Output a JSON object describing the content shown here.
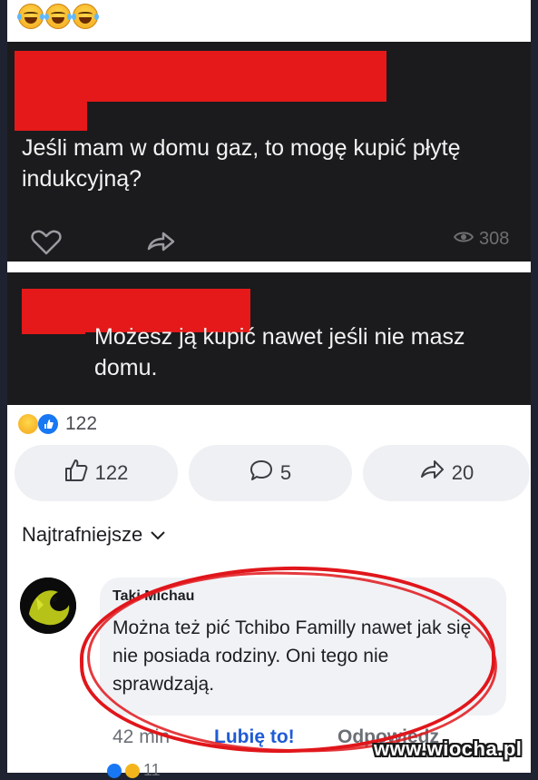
{
  "top_emojis": [
    "laughing-tears-emoji",
    "laughing-tears-emoji",
    "laughing-tears-emoji"
  ],
  "question": {
    "text": "Jeśli mam w domu gaz, to mogę kupić płytę indukcyjną?",
    "views": "308"
  },
  "answer": {
    "text": "Możesz ją kupić nawet jeśli nie masz domu."
  },
  "post_stats": {
    "reaction_count": "122",
    "like_count": "122",
    "comment_count": "5",
    "share_count": "20"
  },
  "comments": {
    "sort_label": "Najtrafniejsze",
    "items": [
      {
        "author": "Taki Michau",
        "text": "Można też pić Tchibo Familly nawet jak się nie posiada rodziny. Oni tego nie sprawdzają.",
        "time": "42 min",
        "like_label": "Lubię to!",
        "reply_label": "Odpowiedz"
      }
    ],
    "next_reaction_count": "11"
  },
  "watermark": "www.wiocha.pl",
  "colors": {
    "redaction": "#e51919",
    "annotation_circle": "#e0161b",
    "link_blue": "#1f5bd6",
    "dark_card": "#1b1b1d"
  }
}
